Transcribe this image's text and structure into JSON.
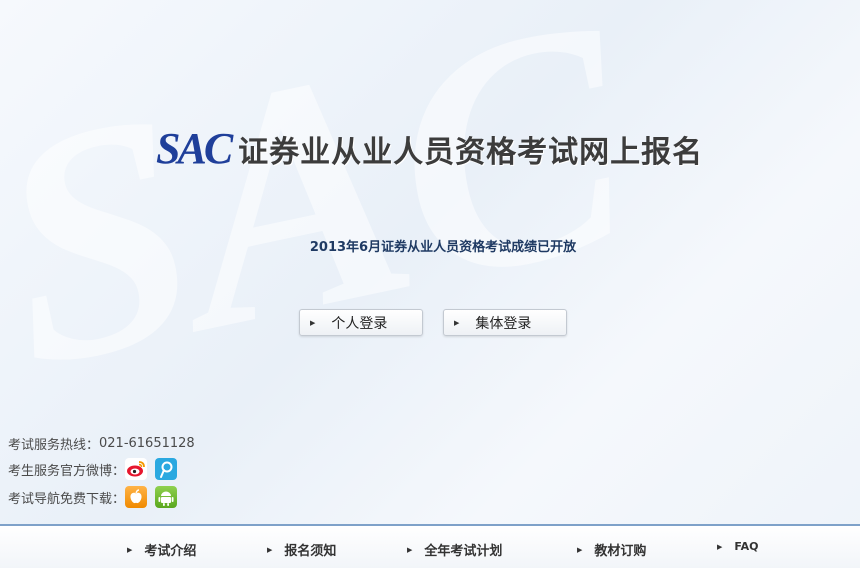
{
  "header": {
    "logo_text": "SAC",
    "site_title": "证券业从业人员资格考试网上报名"
  },
  "notice": "2013年6月证券从业人员资格考试成绩已开放",
  "login": {
    "personal_label": "个人登录",
    "group_label": "集体登录"
  },
  "info": {
    "hotline_label": "考试服务热线：",
    "hotline_number": "021-61651128",
    "weibo_label": "考生服务官方微博：",
    "download_label": "考试导航免费下载："
  },
  "icons": {
    "weibo": "sina-weibo-icon",
    "tencent_weibo": "tencent-weibo-icon",
    "apple": "apple-icon",
    "android": "android-icon"
  },
  "colors": {
    "logo": "#1f3f9a",
    "notice": "#1f3a63",
    "footer_border": "#7ea1c9"
  },
  "footer": {
    "nav": [
      {
        "label": "考试介绍"
      },
      {
        "label": "报名须知"
      },
      {
        "label": "全年考试计划"
      },
      {
        "label": "教材订购"
      },
      {
        "label": "FAQ"
      }
    ]
  }
}
